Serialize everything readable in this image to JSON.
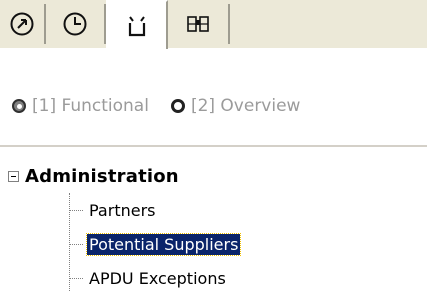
{
  "tabs": [
    {
      "icon": "clock-arrow-icon",
      "active": false
    },
    {
      "icon": "clock-icon",
      "active": false
    },
    {
      "icon": "tray-icon",
      "active": true
    },
    {
      "icon": "binoculars-icon",
      "active": false
    }
  ],
  "view_modes": [
    {
      "label": "[1] Functional",
      "selected": true
    },
    {
      "label": "[2] Overview",
      "selected": false
    }
  ],
  "tree": {
    "root_label": "Administration",
    "expanded": true,
    "children": [
      {
        "label": "Partners",
        "selected": false
      },
      {
        "label": "Potential Suppliers",
        "selected": true
      },
      {
        "label": "APDU Exceptions",
        "selected": false
      }
    ]
  },
  "colors": {
    "selection": "#0a246a",
    "tab_face": "#ece9d8",
    "disabled_text": "#9b9b9b"
  }
}
